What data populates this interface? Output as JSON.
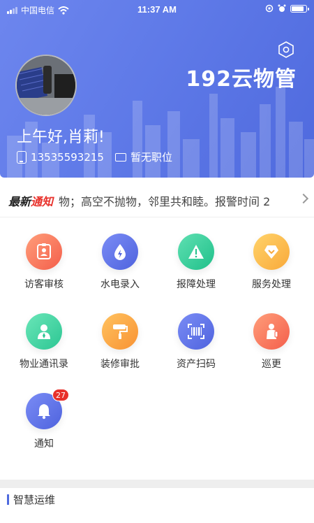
{
  "status": {
    "carrier": "中国电信",
    "time": "11:37 AM"
  },
  "header": {
    "brand": "192云物管",
    "greeting": "上午好,肖莉!",
    "phone": "13535593215",
    "position": "暂无职位"
  },
  "notice": {
    "tag_black": "最新",
    "tag_red": "通知",
    "text": "物；高空不抛物，邻里共和睦。报警时间 2"
  },
  "menu": [
    {
      "label": "访客审核",
      "icon": "visitor-id-icon"
    },
    {
      "label": "水电录入",
      "icon": "water-electric-icon"
    },
    {
      "label": "报障处理",
      "icon": "warning-icon"
    },
    {
      "label": "服务处理",
      "icon": "service-heart-icon"
    },
    {
      "label": "物业通讯录",
      "icon": "contact-person-icon"
    },
    {
      "label": "装修审批",
      "icon": "paint-roller-icon"
    },
    {
      "label": "资产扫码",
      "icon": "barcode-scan-icon"
    },
    {
      "label": "巡更",
      "icon": "patrol-guard-icon"
    },
    {
      "label": "通知",
      "icon": "bell-icon",
      "badge": "27"
    }
  ],
  "section": {
    "title": "智慧运维"
  },
  "colors": {
    "header_accent": "#5f7ae8",
    "notice_red": "#e8312b"
  }
}
